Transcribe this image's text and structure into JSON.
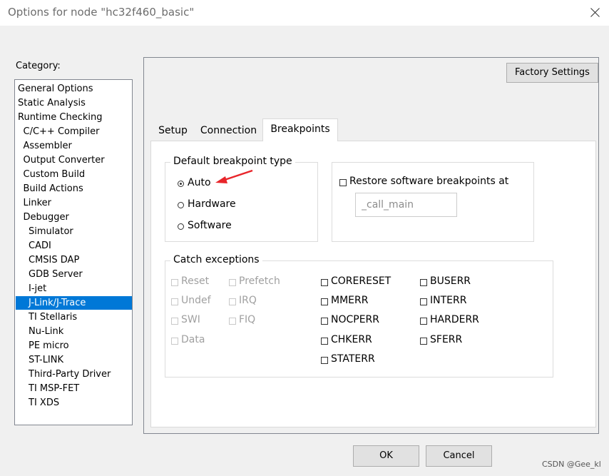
{
  "window": {
    "title": "Options for node \"hc32f460_basic\""
  },
  "category": {
    "label": "Category:",
    "items": [
      {
        "label": "General Options",
        "level": 0
      },
      {
        "label": "Static Analysis",
        "level": 0
      },
      {
        "label": "Runtime Checking",
        "level": 0
      },
      {
        "label": "C/C++ Compiler",
        "level": 1
      },
      {
        "label": "Assembler",
        "level": 1
      },
      {
        "label": "Output Converter",
        "level": 1
      },
      {
        "label": "Custom Build",
        "level": 1
      },
      {
        "label": "Build Actions",
        "level": 1
      },
      {
        "label": "Linker",
        "level": 1
      },
      {
        "label": "Debugger",
        "level": 1
      },
      {
        "label": "Simulator",
        "level": 2
      },
      {
        "label": "CADI",
        "level": 2
      },
      {
        "label": "CMSIS DAP",
        "level": 2
      },
      {
        "label": "GDB Server",
        "level": 2
      },
      {
        "label": "I-jet",
        "level": 2
      },
      {
        "label": "J-Link/J-Trace",
        "level": 2,
        "selected": true
      },
      {
        "label": "TI Stellaris",
        "level": 2
      },
      {
        "label": "Nu-Link",
        "level": 2
      },
      {
        "label": "PE micro",
        "level": 2
      },
      {
        "label": "ST-LINK",
        "level": 2
      },
      {
        "label": "Third-Party Driver",
        "level": 2
      },
      {
        "label": "TI MSP-FET",
        "level": 2
      },
      {
        "label": "TI XDS",
        "level": 2
      }
    ]
  },
  "factory_settings": "Factory Settings",
  "tabs": [
    "Setup",
    "Connection",
    "Breakpoints"
  ],
  "active_tab": "Breakpoints",
  "default_breakpoint": {
    "title": "Default breakpoint type",
    "options": [
      "Auto",
      "Hardware",
      "Software"
    ],
    "selected": "Auto"
  },
  "restore": {
    "label": "Restore software breakpoints at",
    "value": "_call_main"
  },
  "catch_exceptions": {
    "title": "Catch exceptions",
    "disabled_col1": [
      "Reset",
      "Undef",
      "SWI",
      "Data"
    ],
    "disabled_col2": [
      "Prefetch",
      "IRQ",
      "FIQ"
    ],
    "col3": [
      "CORERESET",
      "MMERR",
      "NOCPERR",
      "CHKERR",
      "STATERR"
    ],
    "col4": [
      "BUSERR",
      "INTERR",
      "HARDERR",
      "SFERR"
    ]
  },
  "buttons": {
    "ok": "OK",
    "cancel": "Cancel"
  },
  "watermark": "CSDN @Gee_kl",
  "colors": {
    "selection": "#0078d7",
    "arrow": "#e8252a"
  }
}
